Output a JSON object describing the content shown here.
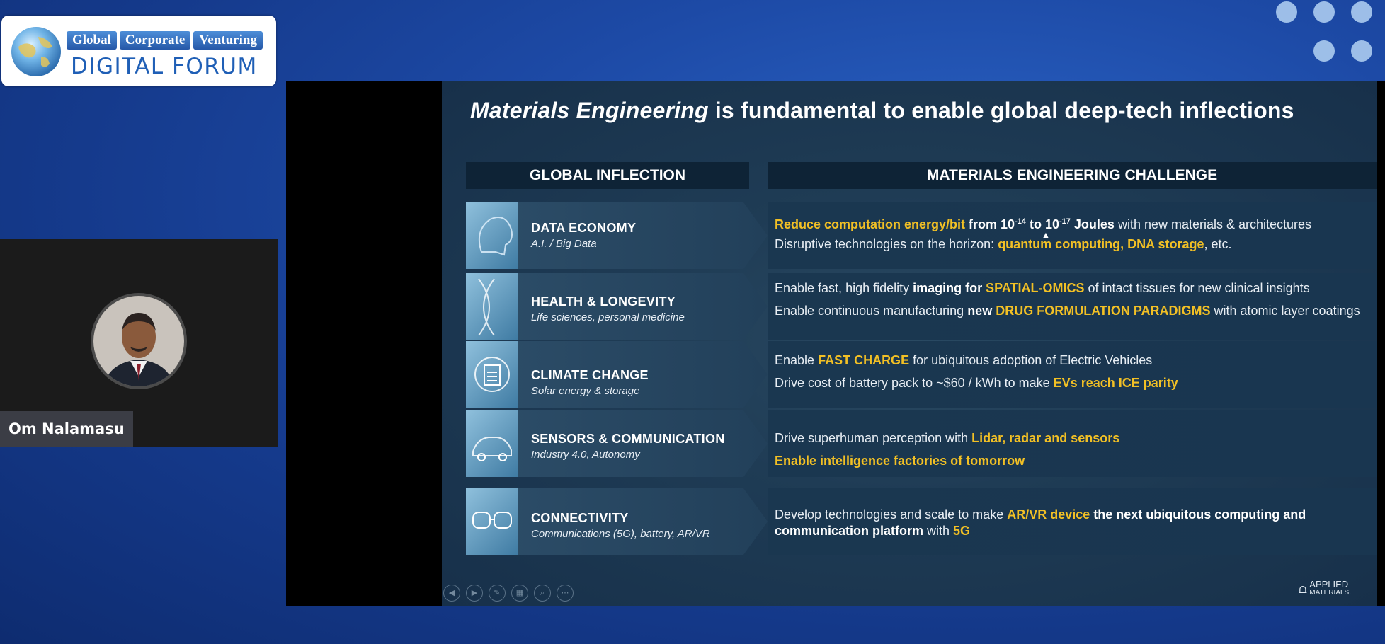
{
  "logo": {
    "tags": [
      "Global",
      "Corporate",
      "Venturing"
    ],
    "title": "DIGITAL FORUM"
  },
  "speaker": {
    "name": "Om Nalamasu"
  },
  "slide": {
    "title_italic": "Materials Engineering",
    "title_rest": " is fundamental to enable global deep-tech inflections",
    "left_header": "GLOBAL INFLECTION",
    "right_header": "MATERIALS ENGINEERING CHALLENGE",
    "rows": [
      {
        "title": "DATA ECONOMY",
        "sub": "A.I. / Big Data"
      },
      {
        "title": "HEALTH & LONGEVITY",
        "sub": "Life sciences, personal medicine"
      },
      {
        "title": "CLIMATE CHANGE",
        "sub": "Solar energy & storage"
      },
      {
        "title": "SENSORS & COMMUNICATION",
        "sub": "Industry 4.0, Autonomy"
      },
      {
        "title": "CONNECTIVITY",
        "sub": "Communications (5G), battery, AR/VR"
      }
    ],
    "challenges": {
      "r1l1": {
        "a": "Reduce computation energy/bit",
        "b": " from 10",
        "c": "-14",
        "d": " to 10",
        "e": "-17",
        "f": " Joules",
        "g": " with new materials & architectures"
      },
      "r1l2": {
        "a": "Disruptive technologies on the horizon: ",
        "b": "quantum computing, DNA storage",
        "c": ", etc."
      },
      "r2l1": {
        "a": "Enable fast, high fidelity ",
        "b": "imaging for ",
        "c": "SPATIAL-OMICS",
        "d": " of intact tissues for new clinical insights"
      },
      "r2l2": {
        "a": "Enable continuous manufacturing ",
        "b": "new ",
        "c": "DRUG FORMULATION PARADIGMS",
        "d": " with atomic layer coatings"
      },
      "r3l1": {
        "a": "Enable ",
        "b": "FAST CHARGE",
        "c": " for ubiquitous adoption of Electric Vehicles"
      },
      "r3l2": {
        "a": "Drive cost of battery pack to ~$60 / kWh to make ",
        "b": "EVs reach ICE parity"
      },
      "r4l1": {
        "a": "Drive superhuman perception with ",
        "b": "Lidar, radar and sensors"
      },
      "r4l2": {
        "a": "Enable intelligence factories of tomorrow"
      },
      "r5l1": {
        "a": "Develop technologies and scale to make ",
        "b": "AR/VR device",
        "c": " the next ubiquitous computing and communication platform",
        "d": " with ",
        "e": "5G"
      }
    },
    "brand_line1": "APPLIED",
    "brand_line2": "MATERIALS."
  },
  "colors": {
    "highlight": "#f2c025",
    "background": "#1d4aa6"
  }
}
